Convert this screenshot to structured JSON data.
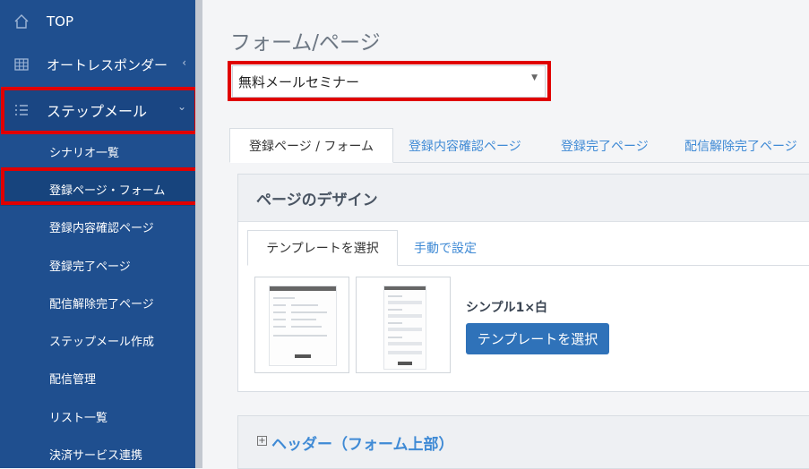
{
  "sidebar": {
    "items": [
      {
        "label": "TOP",
        "icon": "home-icon"
      },
      {
        "label": "オートレスポンダー",
        "icon": "grid-icon",
        "caret": "‹"
      },
      {
        "label": "ステップメール",
        "icon": "list-icon",
        "caret": "⌄"
      }
    ],
    "sub_items": [
      "シナリオ一覧",
      "登録ページ・フォーム",
      "登録内容確認ページ",
      "登録完了ページ",
      "配信解除完了ページ",
      "ステップメール作成",
      "配信管理",
      "リスト一覧",
      "決済サービス連携"
    ],
    "active_sub_index": 1
  },
  "main": {
    "title": "フォーム/ページ",
    "select": {
      "value": "無料メールセミナー"
    },
    "tabs": [
      "登録ページ / フォーム",
      "登録内容確認ページ",
      "登録完了ページ",
      "配信解除完了ページ"
    ],
    "active_tab": 0,
    "design_panel": {
      "title": "ページのデザイン",
      "inner_tabs": [
        "テンプレートを選択",
        "手動で設定"
      ],
      "template_name": "シンプル1×白",
      "select_button": "テンプレートを選択"
    },
    "header_panel": {
      "title": "ヘッダー（フォーム上部）"
    }
  },
  "colors": {
    "sidebar_bg": "#1f4f8f",
    "link": "#3f8ad5",
    "primary_button": "#2f72b9",
    "highlight": "#e00000"
  }
}
